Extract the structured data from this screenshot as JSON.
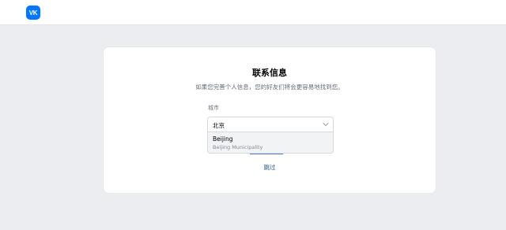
{
  "header": {
    "logo_text": "VK",
    "brand_color": "#0077ff"
  },
  "card": {
    "title": "联系信息",
    "subtitle": "如果您完善个人信息，您的好友们将会更容易地找到您。",
    "city_field": {
      "label": "城市",
      "value": "北京"
    },
    "dropdown": {
      "option_title": "Beijing",
      "option_subtitle": "Beijing Municipality"
    },
    "skip_label": "跳过"
  }
}
